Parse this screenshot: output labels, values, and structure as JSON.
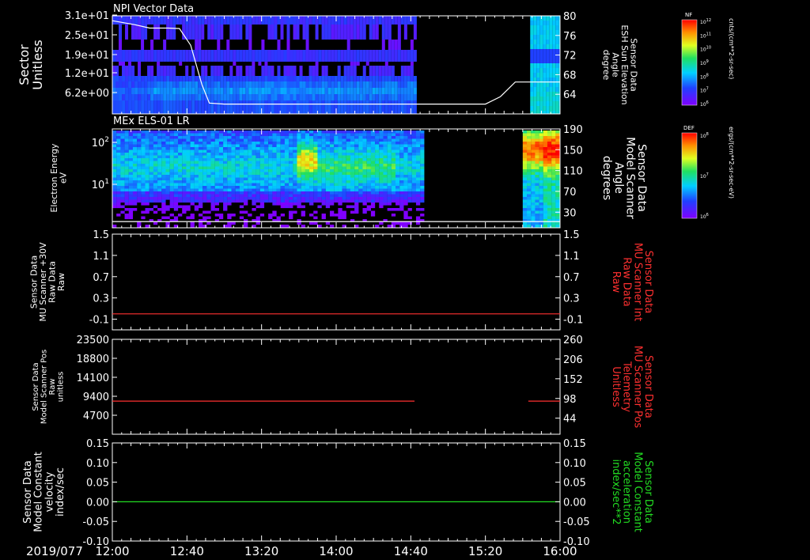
{
  "colors": {
    "background": "#000000",
    "axis": "#ffffff",
    "red": "#ff3030",
    "green": "#22dd22"
  },
  "footer": {
    "date": "2019/077",
    "time_ticks": [
      "12:00",
      "12:40",
      "13:20",
      "14:00",
      "14:40",
      "15:20",
      "16:00"
    ]
  },
  "chart_data": [
    {
      "type": "heatmap",
      "title": "NPI Vector Data",
      "ylabel": [
        "Sector",
        "Unitless"
      ],
      "yticks": [
        "3.1e+01",
        "2.5e+01",
        "1.9e+01",
        "1.2e+01",
        "6.2e+00"
      ],
      "ylabel_right": [
        "Sensor Data",
        "ESH Sun Elevation",
        "Angle",
        "degree"
      ],
      "yticks_right": [
        "80",
        "76",
        "72",
        "68",
        "64"
      ],
      "ylim_right": [
        60,
        80
      ],
      "data_gaps_x": [
        [
          "14:42",
          "15:44"
        ]
      ],
      "overlay_line": {
        "color": "#ffffff",
        "x": [
          "12:00",
          "12:12",
          "12:20",
          "12:30",
          "12:36",
          "12:42",
          "12:48",
          "12:52",
          "13:00",
          "14:00",
          "15:20",
          "15:28",
          "15:36",
          "16:00"
        ],
        "y": [
          79,
          78.2,
          77.5,
          77.5,
          77.4,
          74,
          66,
          62.2,
          62,
          62,
          62,
          63.5,
          66.5,
          66.5
        ]
      },
      "colorbar": {
        "label": "NF",
        "unit": "cnts/(cm**2-sr-sec)",
        "ticks": [
          "10^12",
          "10^11",
          "10^10",
          "10^9",
          "10^8",
          "10^7",
          "10^6"
        ]
      }
    },
    {
      "type": "heatmap",
      "title": "MEx ELS-01 LR",
      "ylabel": [
        "Electron Energy",
        "eV"
      ],
      "yticks": [
        "10^2",
        "10^1"
      ],
      "ylabel_right": [
        "Sensor Data",
        "Model Scanner",
        "Angle",
        "degrees"
      ],
      "yticks_right": [
        "190",
        "150",
        "110",
        "70",
        "30"
      ],
      "ylim_right": [
        0,
        190
      ],
      "data_gaps_x": [
        [
          "14:46",
          "15:40"
        ]
      ],
      "overlay_line": {
        "color": "#ffffff",
        "x": [
          "12:00",
          "16:00"
        ],
        "y": [
          12,
          12
        ]
      },
      "colorbar": {
        "label": "DEF",
        "unit": "ergs/(cm**2-sr-sec-eV)",
        "ticks": [
          "10^8",
          "10^7",
          "10^6"
        ]
      }
    },
    {
      "type": "line",
      "ylabel": [
        "Sensor Data",
        "MU Scanner +30V",
        "Raw Data",
        "Raw"
      ],
      "yticks": [
        "1.5",
        "1.1",
        "0.7",
        "0.3",
        "-0.1"
      ],
      "ylim": [
        -0.3,
        1.5
      ],
      "ylabel_right": [
        "Sensor Data",
        "MU Scanner Int",
        "Raw Data",
        "Raw"
      ],
      "yticks_right": [
        "1.5",
        "1.1",
        "0.7",
        "0.3",
        "-0.1"
      ],
      "series": [
        {
          "color": "#ff3030",
          "segments": [
            {
              "x": [
                "12:00",
                "16:00"
              ],
              "y": [
                0.0,
                0.0
              ]
            }
          ]
        }
      ]
    },
    {
      "type": "line",
      "ylabel": [
        "Sensor Data",
        "Model Scanner Pos",
        "Raw",
        "unitless"
      ],
      "yticks": [
        "23500",
        "18800",
        "14100",
        "9400",
        "4700"
      ],
      "ylim": [
        0,
        23500
      ],
      "ylabel_right": [
        "Sensor Data",
        "MU Scanner Pos",
        "Telemetry",
        "Unitless"
      ],
      "yticks_right": [
        "260",
        "206",
        "152",
        "98",
        "44"
      ],
      "series": [
        {
          "color": "#ff3030",
          "segments": [
            {
              "x": [
                "12:00",
                "14:42"
              ],
              "y": [
                8200,
                8200
              ]
            },
            {
              "x": [
                "15:43",
                "16:00"
              ],
              "y": [
                8200,
                8200
              ]
            }
          ]
        }
      ]
    },
    {
      "type": "line",
      "ylabel": [
        "Sensor Data",
        "Model Constant",
        "velocity",
        "index/sec"
      ],
      "yticks": [
        "0.15",
        "0.10",
        "0.05",
        "0.00",
        "-0.05",
        "-0.10"
      ],
      "ylim": [
        -0.1,
        0.15
      ],
      "ylabel_right": [
        "Sensor Data",
        "Model Constant",
        "acceleration",
        "index/sec**2"
      ],
      "yticks_right": [
        "0.15",
        "0.10",
        "0.05",
        "0.00",
        "-0.05",
        "-0.10"
      ],
      "series": [
        {
          "color": "#22dd22",
          "segments": [
            {
              "x": [
                "12:00",
                "16:00"
              ],
              "y": [
                0.0,
                0.0
              ]
            }
          ]
        }
      ]
    }
  ]
}
